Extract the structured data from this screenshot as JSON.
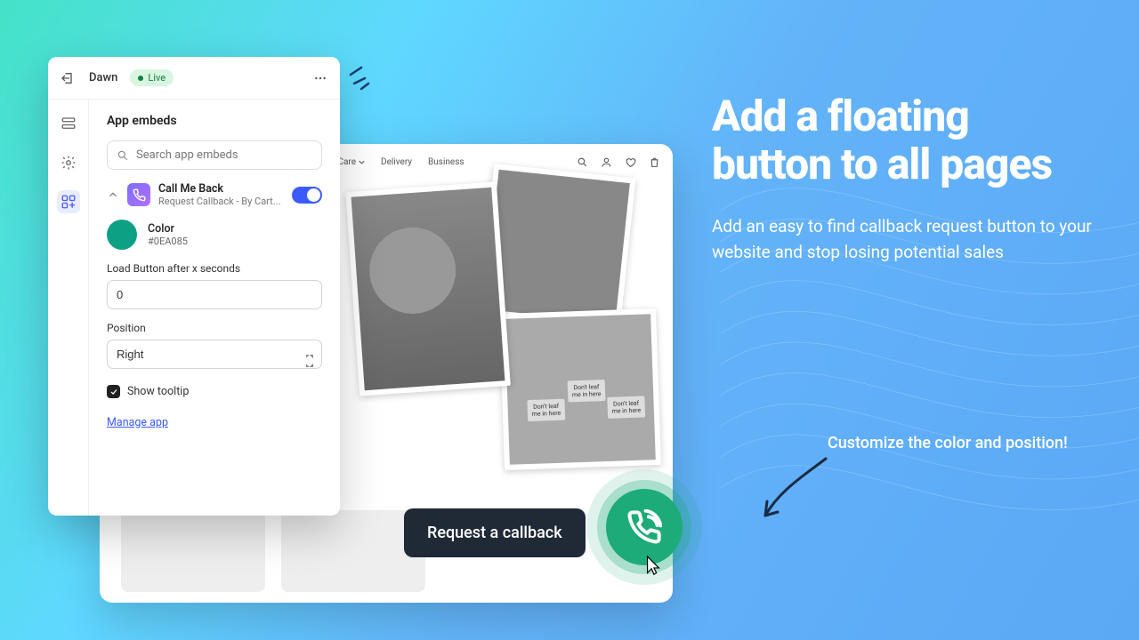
{
  "marketing": {
    "heading": "Add a floating button to all pages",
    "body": "Add an easy to find callback request button to your website and stop losing potential sales",
    "sub": "Customize the color and position!"
  },
  "tooltip_label": "Request a callback",
  "panel": {
    "theme": "Dawn",
    "badge": "Live",
    "section": "App embeds",
    "search_placeholder": "Search app embeds",
    "app": {
      "title": "Call Me Back",
      "subtitle": "Request Callback - By Cart..."
    },
    "color": {
      "label": "Color",
      "hex": "#0EA085"
    },
    "delay": {
      "label": "Load Button after x seconds",
      "value": "0"
    },
    "position": {
      "label": "Position",
      "value": "Right"
    },
    "show_tooltip_label": "Show tooltip",
    "manage_link": "Manage app"
  },
  "storefront": {
    "nav": [
      "Plant Care",
      "Delivery",
      "Business"
    ]
  },
  "colors": {
    "accent": "#0EA085"
  }
}
